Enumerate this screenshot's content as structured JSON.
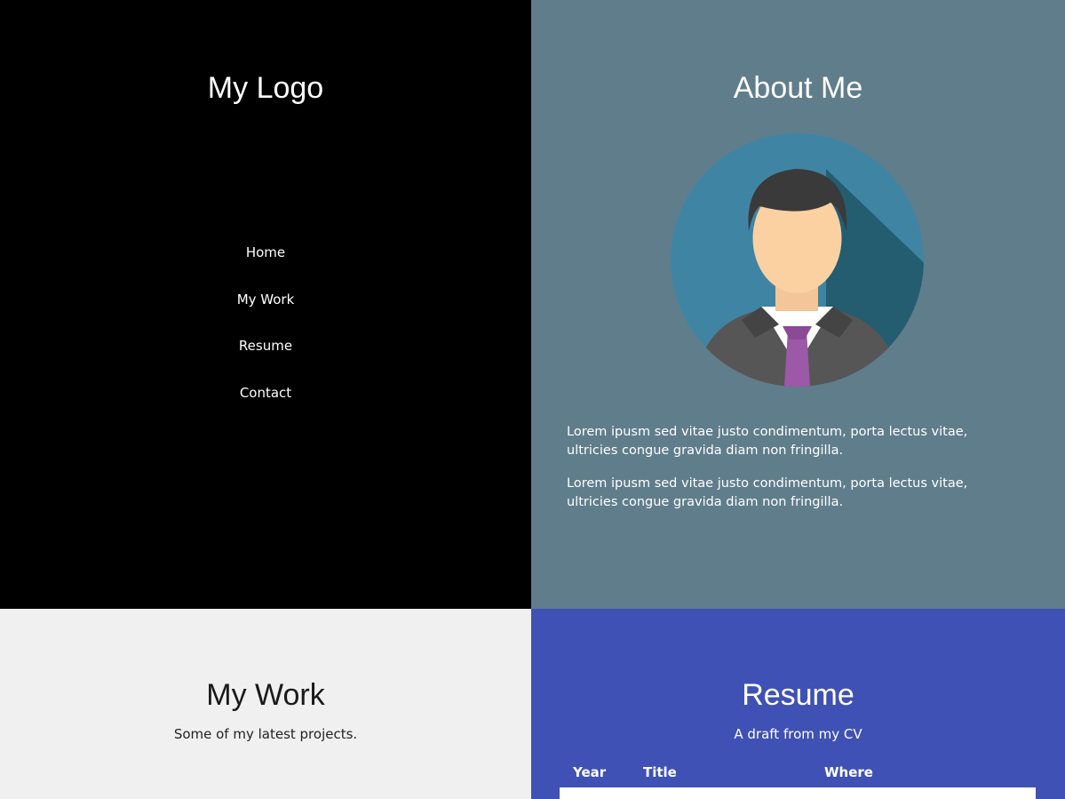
{
  "nav": {
    "logo": "My Logo",
    "items": [
      {
        "label": "Home"
      },
      {
        "label": "My Work"
      },
      {
        "label": "Resume"
      },
      {
        "label": "Contact"
      }
    ]
  },
  "about": {
    "title": "About Me",
    "avatar_icon": "businessman-avatar-icon",
    "paragraphs": [
      "Lorem ipusm sed vitae justo condimentum, porta lectus vitae, ultricies congue gravida diam non fringilla.",
      "Lorem ipusm sed vitae justo condimentum, porta lectus vitae, ultricies congue gravida diam non fringilla."
    ]
  },
  "work": {
    "title": "My Work",
    "subtitle": "Some of my latest projects."
  },
  "resume": {
    "title": "Resume",
    "subtitle": "A draft from my CV",
    "columns": [
      "Year",
      "Title",
      "Where"
    ]
  },
  "colors": {
    "nav_bg": "#000000",
    "about_bg": "#607d8b",
    "work_bg": "#f0f0f0",
    "resume_bg": "#3f51b5",
    "avatar_circle": "#3d7e99",
    "tie": "#9b59a8"
  }
}
